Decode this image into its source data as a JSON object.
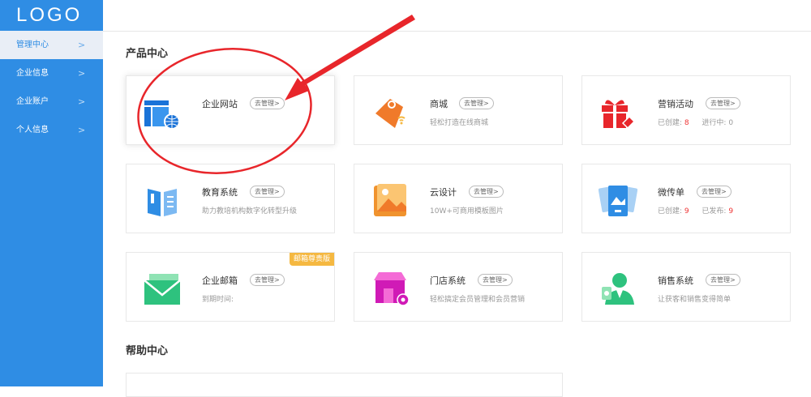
{
  "logo": "LOGO",
  "sidebar": {
    "items": [
      {
        "label": "管理中心",
        "active": true
      },
      {
        "label": "企业信息",
        "active": false
      },
      {
        "label": "企业账户",
        "active": false
      },
      {
        "label": "个人信息",
        "active": false
      }
    ],
    "chevron": ">"
  },
  "sections": {
    "products_title": "产品中心",
    "help_title": "帮助中心"
  },
  "manage_label": "去管理>",
  "cards": [
    {
      "title": "企业网站",
      "icon": "website-icon"
    },
    {
      "title": "商城",
      "desc": "轻松打造在线商城",
      "icon": "shop-bag-icon"
    },
    {
      "title": "营销活动",
      "icon": "gift-icon",
      "stat1_label": "已创建:",
      "stat1_value": "8",
      "stat2_label": "进行中:",
      "stat2_value": "0"
    },
    {
      "title": "教育系统",
      "desc": "助力教培机构数字化转型升级",
      "icon": "book-icon"
    },
    {
      "title": "云设计",
      "desc": "10W+可商用模板图片",
      "icon": "image-icon"
    },
    {
      "title": "微传单",
      "icon": "flyer-icon",
      "stat1_label": "已创建:",
      "stat1_value": "9",
      "stat2_label": "已发布:",
      "stat2_value": "9"
    },
    {
      "title": "企业邮箱",
      "desc": "到期时间:",
      "icon": "mail-icon",
      "badge": "邮箱尊贵版"
    },
    {
      "title": "门店系统",
      "desc": "轻松搞定会员管理和会员营销",
      "icon": "store-icon"
    },
    {
      "title": "销售系统",
      "desc": "让获客和销售变得简单",
      "icon": "salesperson-icon"
    }
  ],
  "colors": {
    "sidebar": "#2f8de4",
    "annotation": "#e8262b",
    "stat_number": "#e33333",
    "badge": "#f5b841"
  }
}
